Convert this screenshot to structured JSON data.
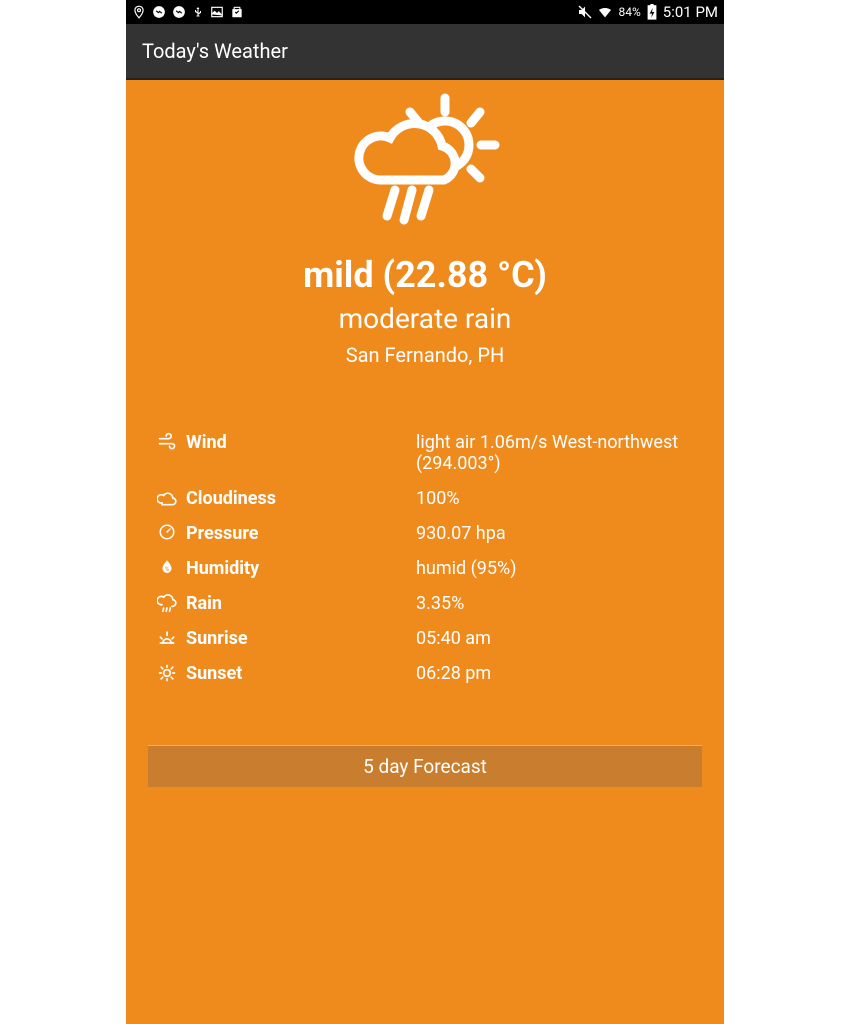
{
  "status": {
    "battery": "84%",
    "time": "5:01 PM"
  },
  "appbar": {
    "title": "Today's Weather"
  },
  "weather": {
    "headline": "mild (22.88 °C)",
    "condition": "moderate rain",
    "location": "San Fernando, PH"
  },
  "details": {
    "wind": {
      "label": "Wind",
      "value": "light air 1.06m/s West-northwest (294.003°)"
    },
    "cloudiness": {
      "label": "Cloudiness",
      "value": "100%"
    },
    "pressure": {
      "label": "Pressure",
      "value": "930.07 hpa"
    },
    "humidity": {
      "label": "Humidity",
      "value": "humid (95%)"
    },
    "rain": {
      "label": "Rain",
      "value": "3.35%"
    },
    "sunrise": {
      "label": "Sunrise",
      "value": "05:40 am"
    },
    "sunset": {
      "label": "Sunset",
      "value": "06:28 pm"
    }
  },
  "forecast_button": "5 day Forecast"
}
